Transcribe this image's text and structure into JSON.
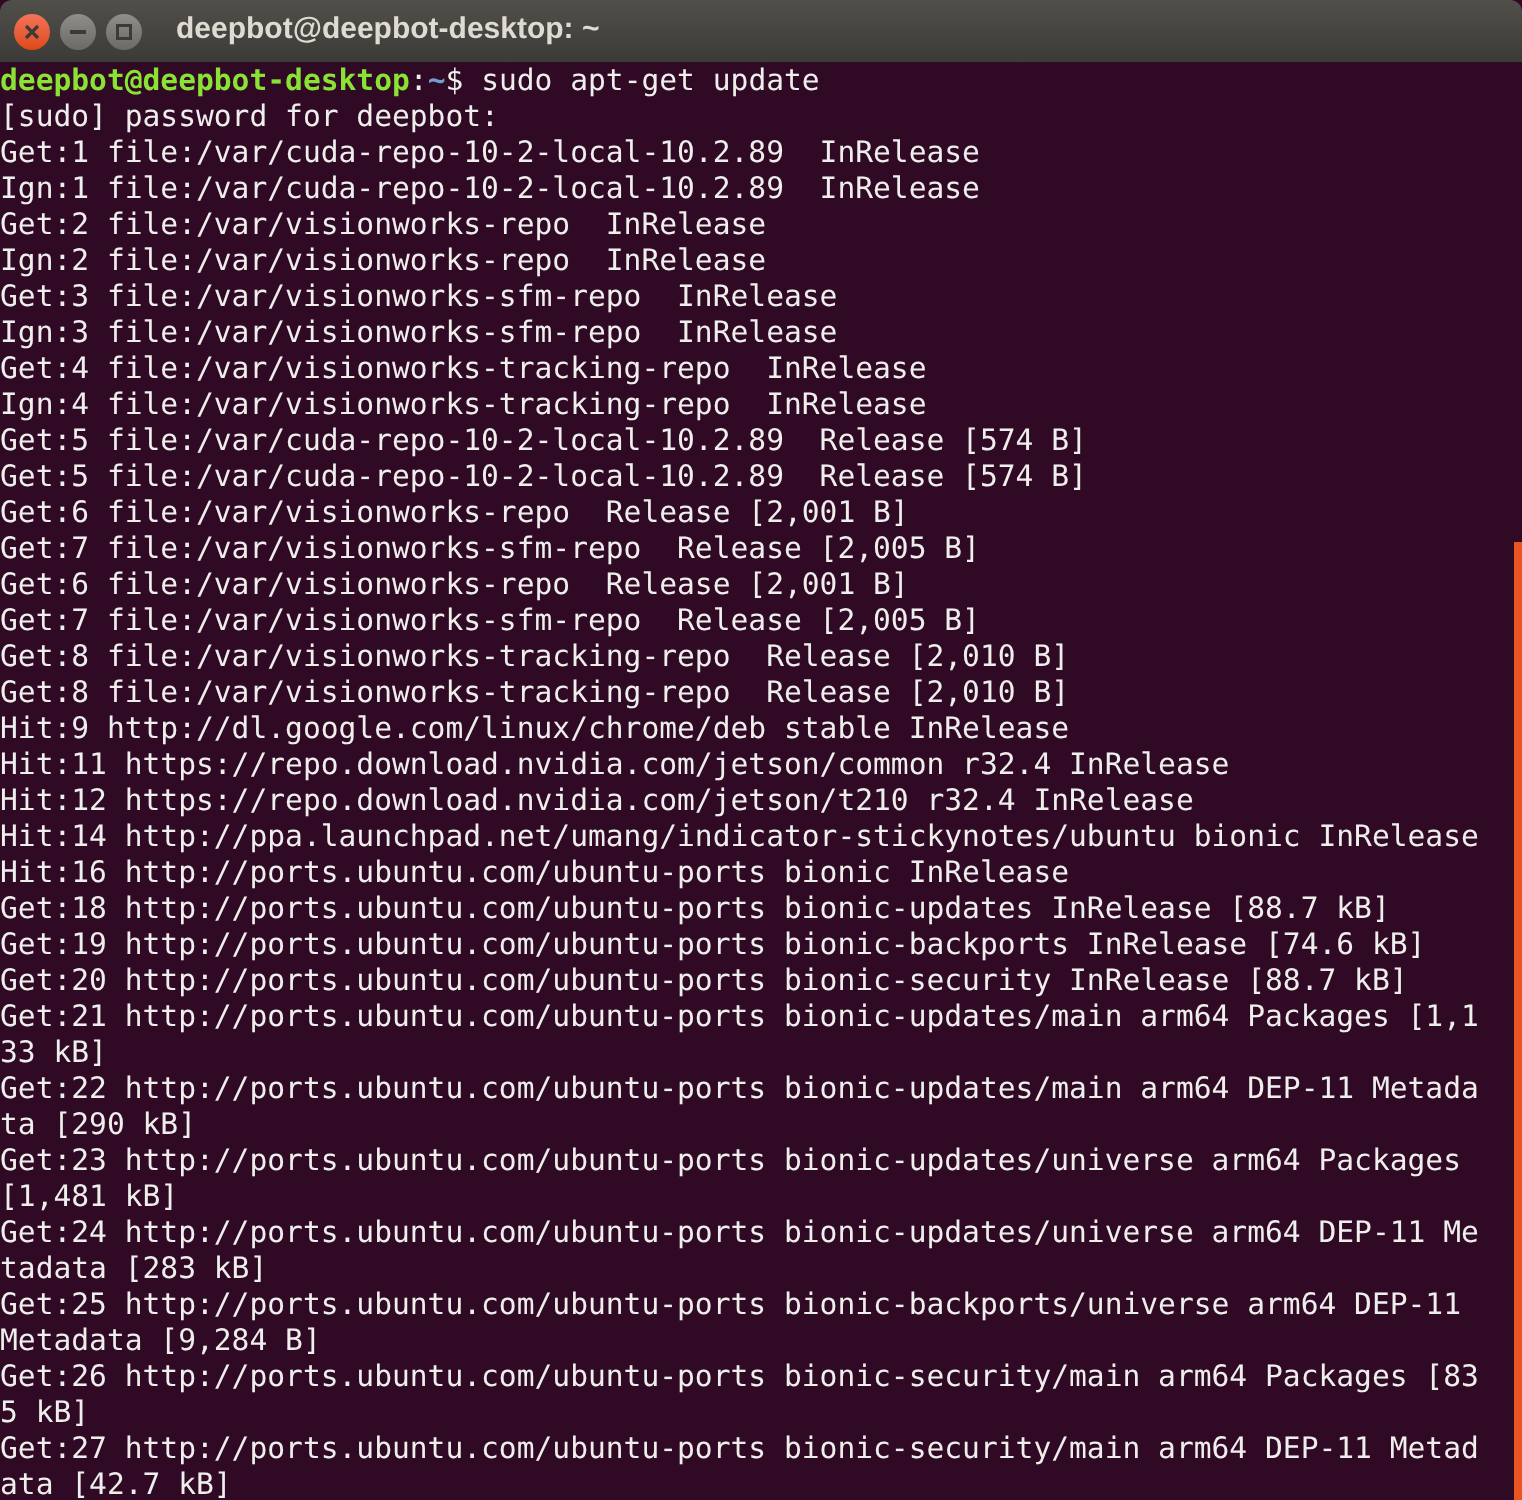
{
  "window": {
    "title": "deepbot@deepbot-desktop: ~"
  },
  "prompt": {
    "user_host": "deepbot@deepbot-desktop",
    "separator": ":",
    "path": "~",
    "symbol": "$",
    "command": "sudo apt-get update"
  },
  "output": [
    "[sudo] password for deepbot:",
    "Get:1 file:/var/cuda-repo-10-2-local-10.2.89  InRelease",
    "Ign:1 file:/var/cuda-repo-10-2-local-10.2.89  InRelease",
    "Get:2 file:/var/visionworks-repo  InRelease",
    "Ign:2 file:/var/visionworks-repo  InRelease",
    "Get:3 file:/var/visionworks-sfm-repo  InRelease",
    "Ign:3 file:/var/visionworks-sfm-repo  InRelease",
    "Get:4 file:/var/visionworks-tracking-repo  InRelease",
    "Ign:4 file:/var/visionworks-tracking-repo  InRelease",
    "Get:5 file:/var/cuda-repo-10-2-local-10.2.89  Release [574 B]",
    "Get:5 file:/var/cuda-repo-10-2-local-10.2.89  Release [574 B]",
    "Get:6 file:/var/visionworks-repo  Release [2,001 B]",
    "Get:7 file:/var/visionworks-sfm-repo  Release [2,005 B]",
    "Get:6 file:/var/visionworks-repo  Release [2,001 B]",
    "Get:7 file:/var/visionworks-sfm-repo  Release [2,005 B]",
    "Get:8 file:/var/visionworks-tracking-repo  Release [2,010 B]",
    "Get:8 file:/var/visionworks-tracking-repo  Release [2,010 B]",
    "Hit:9 http://dl.google.com/linux/chrome/deb stable InRelease",
    "Hit:11 https://repo.download.nvidia.com/jetson/common r32.4 InRelease",
    "Hit:12 https://repo.download.nvidia.com/jetson/t210 r32.4 InRelease",
    "Hit:14 http://ppa.launchpad.net/umang/indicator-stickynotes/ubuntu bionic InRelease",
    "Hit:16 http://ports.ubuntu.com/ubuntu-ports bionic InRelease",
    "Get:18 http://ports.ubuntu.com/ubuntu-ports bionic-updates InRelease [88.7 kB]",
    "Get:19 http://ports.ubuntu.com/ubuntu-ports bionic-backports InRelease [74.6 kB]",
    "Get:20 http://ports.ubuntu.com/ubuntu-ports bionic-security InRelease [88.7 kB]",
    "Get:21 http://ports.ubuntu.com/ubuntu-ports bionic-updates/main arm64 Packages [1,1",
    "33 kB]",
    "Get:22 http://ports.ubuntu.com/ubuntu-ports bionic-updates/main arm64 DEP-11 Metada",
    "ta [290 kB]",
    "Get:23 http://ports.ubuntu.com/ubuntu-ports bionic-updates/universe arm64 Packages",
    "[1,481 kB]",
    "Get:24 http://ports.ubuntu.com/ubuntu-ports bionic-updates/universe arm64 DEP-11 Me",
    "tadata [283 kB]",
    "Get:25 http://ports.ubuntu.com/ubuntu-ports bionic-backports/universe arm64 DEP-11",
    "Metadata [9,284 B]",
    "Get:26 http://ports.ubuntu.com/ubuntu-ports bionic-security/main arm64 Packages [83",
    "5 kB]",
    "Get:27 http://ports.ubuntu.com/ubuntu-ports bionic-security/main arm64 DEP-11 Metad",
    "ata [42.7 kB]"
  ]
}
